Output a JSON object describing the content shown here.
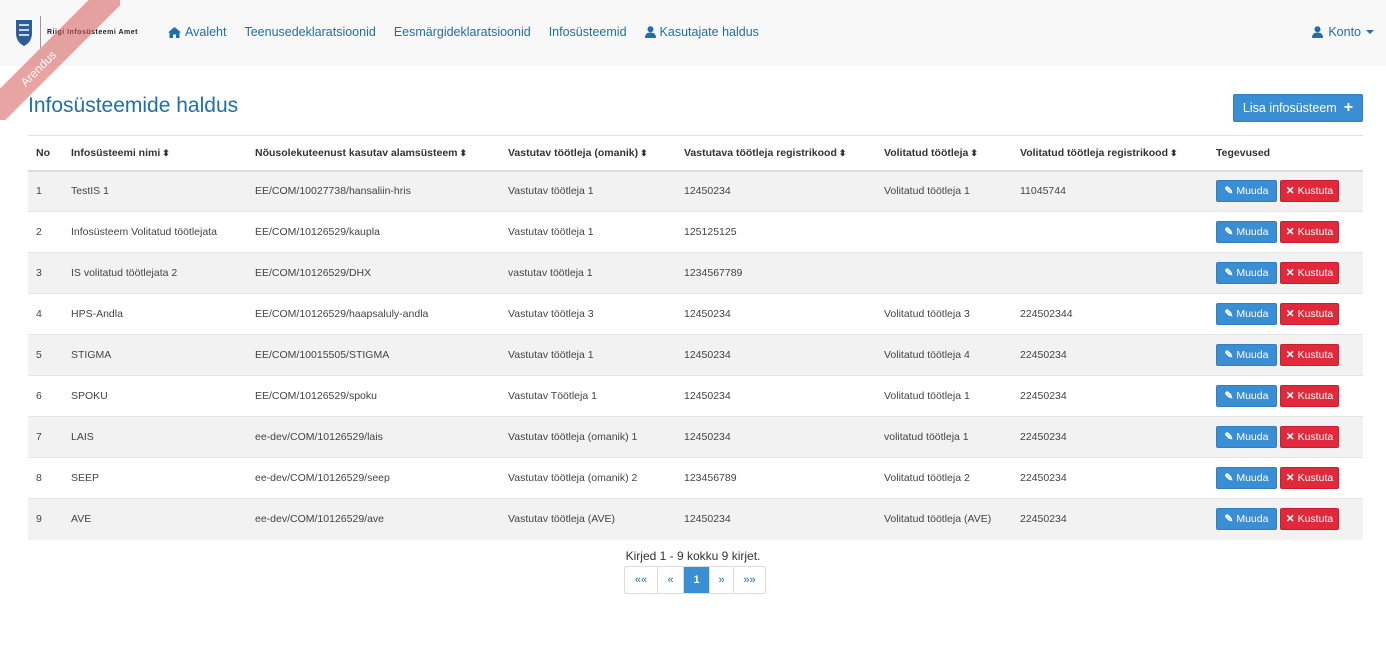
{
  "ribbon": "Arendus",
  "logo": {
    "text": "Riigi Infosüsteemi Amet"
  },
  "nav": [
    {
      "label": "Avaleht",
      "icon": "home-icon"
    },
    {
      "label": "Teenusedeklaratsioonid"
    },
    {
      "label": "Eesmärgideklaratsioonid"
    },
    {
      "label": "Infosüsteemid"
    },
    {
      "label": "Kasutajate haldus",
      "icon": "user-icon"
    }
  ],
  "account": {
    "label": "Konto"
  },
  "page": {
    "title": "Infosüsteemide haldus",
    "add_button": "Lisa infosüsteem"
  },
  "table": {
    "headers": [
      "No",
      "Infosüsteemi nimi",
      "Nõusolekuteenust kasutav alamsüsteem",
      "Vastutav töötleja (omanik)",
      "Vastutava töötleja registrikood",
      "Volitatud töötleja",
      "Volitatud töötleja registrikood",
      "Tegevused"
    ],
    "edit_label": "Muuda",
    "delete_label": "Kustuta",
    "rows": [
      [
        "1",
        "TestIS 1",
        "EE/COM/10027738/hansaliin-hris",
        "Vastutav töötleja 1",
        "12450234",
        "Volitatud töötleja 1",
        "11045744"
      ],
      [
        "2",
        "Infosüsteem Volitatud töötlejata",
        "EE/COM/10126529/kaupla",
        "Vastutav töötleja 1",
        "125125125",
        "",
        ""
      ],
      [
        "3",
        "IS volitatud töötlejata 2",
        "EE/COM/10126529/DHX",
        "vastutav töötleja 1",
        "1234567789",
        "",
        ""
      ],
      [
        "4",
        "HPS-Andla",
        "EE/COM/10126529/haapsaluly-andla",
        "Vastutav töötleja 3",
        "12450234",
        "Volitatud töötleja 3",
        "224502344"
      ],
      [
        "5",
        "STIGMA",
        "EE/COM/10015505/STIGMA",
        "Vastutav töötleja 1",
        "12450234",
        "Volitatud töötleja 4",
        "22450234"
      ],
      [
        "6",
        "SPOKU",
        "EE/COM/10126529/spoku",
        "Vastutav Töötleja 1",
        "12450234",
        "Volitatud töötleja 1",
        "22450234"
      ],
      [
        "7",
        "LAIS",
        "ee-dev/COM/10126529/lais",
        "Vastutav töötleja (omanik) 1",
        "12450234",
        "volitatud töötleja 1",
        "22450234"
      ],
      [
        "8",
        "SEEP",
        "ee-dev/COM/10126529/seep",
        "Vastutav töötleja (omanik) 2",
        "123456789",
        "Volitatud töötleja 2",
        "22450234"
      ],
      [
        "9",
        "AVE",
        "ee-dev/COM/10126529/ave",
        "Vastutav töötleja (AVE)",
        "12450234",
        "Volitatud töötleja (AVE)",
        "22450234"
      ]
    ]
  },
  "pagination": {
    "info": "Kirjed 1 - 9 kokku 9 kirjet.",
    "first": "««",
    "prev": "«",
    "current": "1",
    "next": "»",
    "last": "»»"
  },
  "colors": {
    "primary": "#3a8fd4",
    "danger": "#e02a3c",
    "link": "#1f6fa8"
  }
}
